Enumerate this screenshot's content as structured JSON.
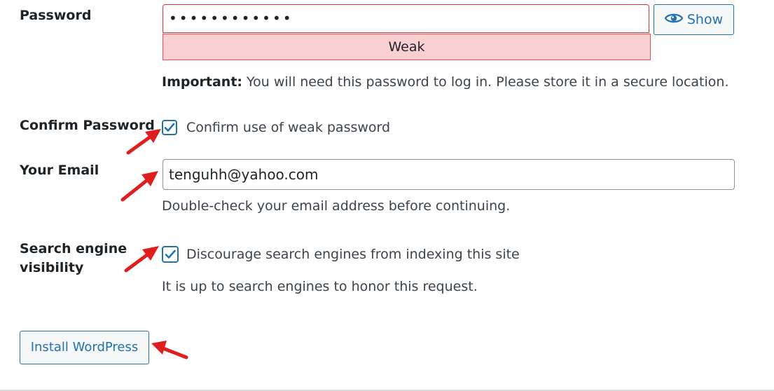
{
  "password": {
    "label": "Password",
    "value": "••••••••••••",
    "strength": "Weak",
    "show_label": "Show",
    "show_icon": "eye-icon",
    "important_strong": "Important:",
    "important_text": " You will need this password to log in. Please store it in a secure location."
  },
  "confirm": {
    "label": "Confirm Password",
    "checkbox_label": "Confirm use of weak password",
    "checked": true
  },
  "email": {
    "label": "Your Email",
    "value": "tenguhh@yahoo.com",
    "hint": "Double-check your email address before continuing."
  },
  "search": {
    "label_line1": "Search engine",
    "label_line2": "visibility",
    "checkbox_label": "Discourage search engines from indexing this site",
    "checked": true,
    "hint": "It is up to search engines to honor this request."
  },
  "install": {
    "label": "Install WordPress"
  },
  "colors": {
    "accent": "#2271b1",
    "weak_bg": "#facfd2",
    "weak_border": "#e65054",
    "arrow": "#e01e1e"
  }
}
